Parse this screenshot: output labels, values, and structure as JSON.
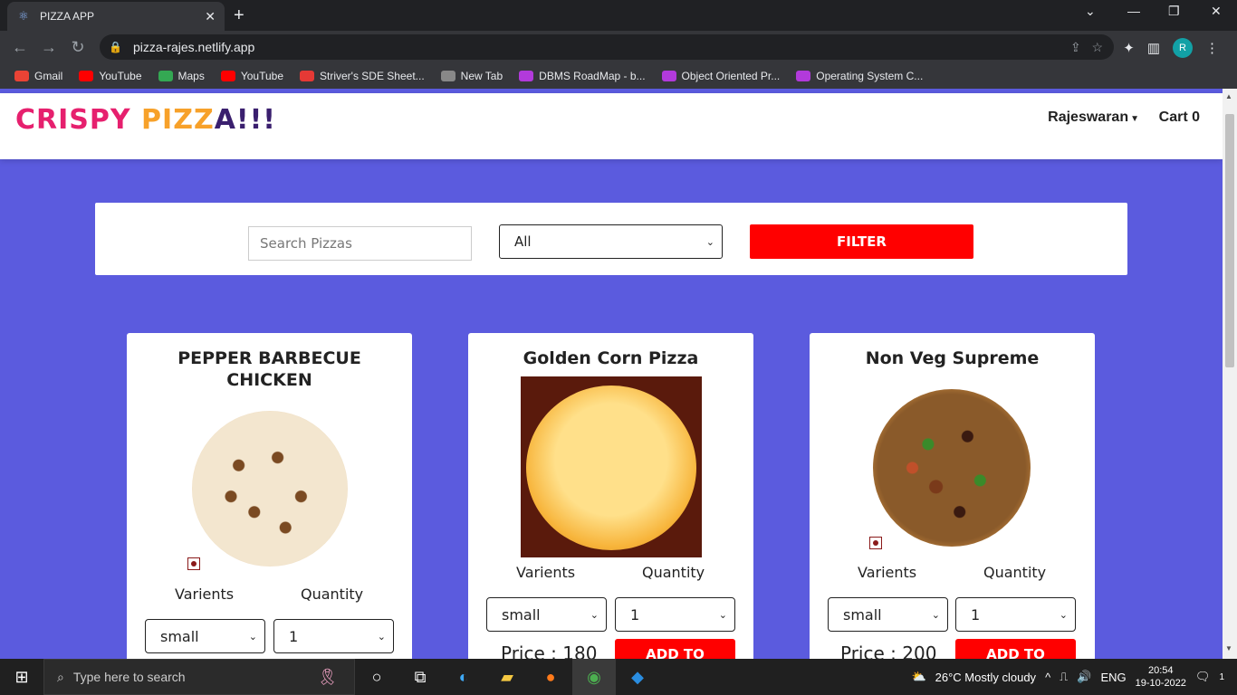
{
  "browser": {
    "tab_title": "PIZZA APP",
    "tab_close": "✕",
    "new_tab": "+",
    "url": "pizza-rajes.netlify.app",
    "profile_initial": "R",
    "window_controls": [
      "⌄",
      "—",
      "❐",
      "✕"
    ]
  },
  "bookmarks": [
    {
      "label": "Gmail",
      "color": "#ea4335"
    },
    {
      "label": "YouTube",
      "color": "#ff0000"
    },
    {
      "label": "Maps",
      "color": "#34a853"
    },
    {
      "label": "YouTube",
      "color": "#ff0000"
    },
    {
      "label": "Striver's SDE Sheet...",
      "color": "#e53935"
    },
    {
      "label": "New Tab",
      "color": "#888888"
    },
    {
      "label": "DBMS RoadMap - b...",
      "color": "#b23adb"
    },
    {
      "label": "Object Oriented Pr...",
      "color": "#b23adb"
    },
    {
      "label": "Operating System C...",
      "color": "#b23adb"
    }
  ],
  "header": {
    "brand_parts": [
      {
        "text": "CRISPY ",
        "color": "#e6206e"
      },
      {
        "text": "PIZZ",
        "color": "#f7a12a"
      },
      {
        "text": "A!!!",
        "color": "#3a1f6e"
      }
    ],
    "user": "Rajeswaran",
    "cart": "Cart 0"
  },
  "filter": {
    "search_placeholder": "Search Pizzas",
    "category_selected": "All",
    "button": "FILTER"
  },
  "pizzas": [
    {
      "name_line1": "PEPPER BARBECUE",
      "name_line2": "CHICKEN",
      "variants_label": "Varients",
      "quantity_label": "Quantity",
      "variant": "small",
      "quantity": "1",
      "price": "",
      "add": ""
    },
    {
      "name_line1": "Golden Corn Pizza",
      "name_line2": "",
      "variants_label": "Varients",
      "quantity_label": "Quantity",
      "variant": "small",
      "quantity": "1",
      "price": "Price : 180",
      "add": "ADD TO"
    },
    {
      "name_line1": "Non Veg Supreme",
      "name_line2": "",
      "variants_label": "Varients",
      "quantity_label": "Quantity",
      "variant": "small",
      "quantity": "1",
      "price": "Price : 200",
      "add": "ADD TO"
    }
  ],
  "taskbar": {
    "search_placeholder": "Type here to search",
    "weather": "26°C  Mostly cloudy",
    "lang": "ENG",
    "time": "20:54",
    "date": "19-10-2022",
    "notifications": "1"
  }
}
